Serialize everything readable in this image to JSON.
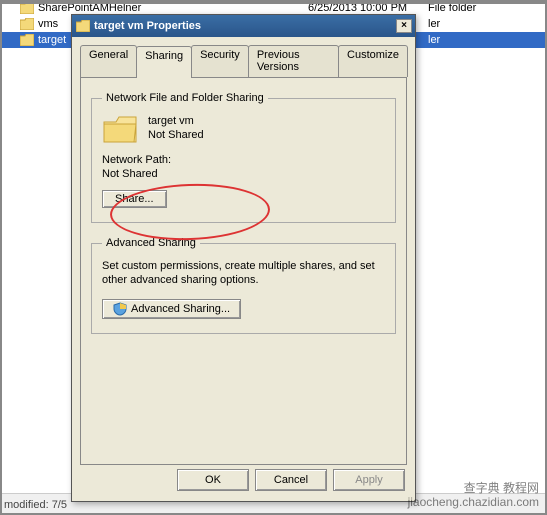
{
  "explorer": {
    "rows": [
      {
        "name": "SharePointAMHelner",
        "date": "6/25/2013 10:00 PM",
        "type": "File folder"
      },
      {
        "name": "vms",
        "date": "",
        "type": "ler"
      },
      {
        "name": "target",
        "date": "",
        "type": "ler"
      }
    ],
    "status": "modified: 7/5"
  },
  "dialog": {
    "title": "target vm Properties",
    "close": "×",
    "tabs": {
      "general": "General",
      "sharing": "Sharing",
      "security": "Security",
      "prev": "Previous Versions",
      "customize": "Customize"
    },
    "nfs": {
      "legend": "Network File and Folder Sharing",
      "name": "target vm",
      "status": "Not Shared",
      "path_label": "Network Path:",
      "path_value": "Not Shared",
      "share_btn": "Share..."
    },
    "adv": {
      "legend": "Advanced Sharing",
      "desc": "Set custom permissions, create multiple shares, and set other advanced sharing options.",
      "btn": "Advanced Sharing..."
    },
    "ok": "OK",
    "cancel": "Cancel",
    "apply": "Apply"
  },
  "watermark": {
    "line1": "查字典 教程网",
    "line2": "jiaocheng.chazidian.com"
  }
}
